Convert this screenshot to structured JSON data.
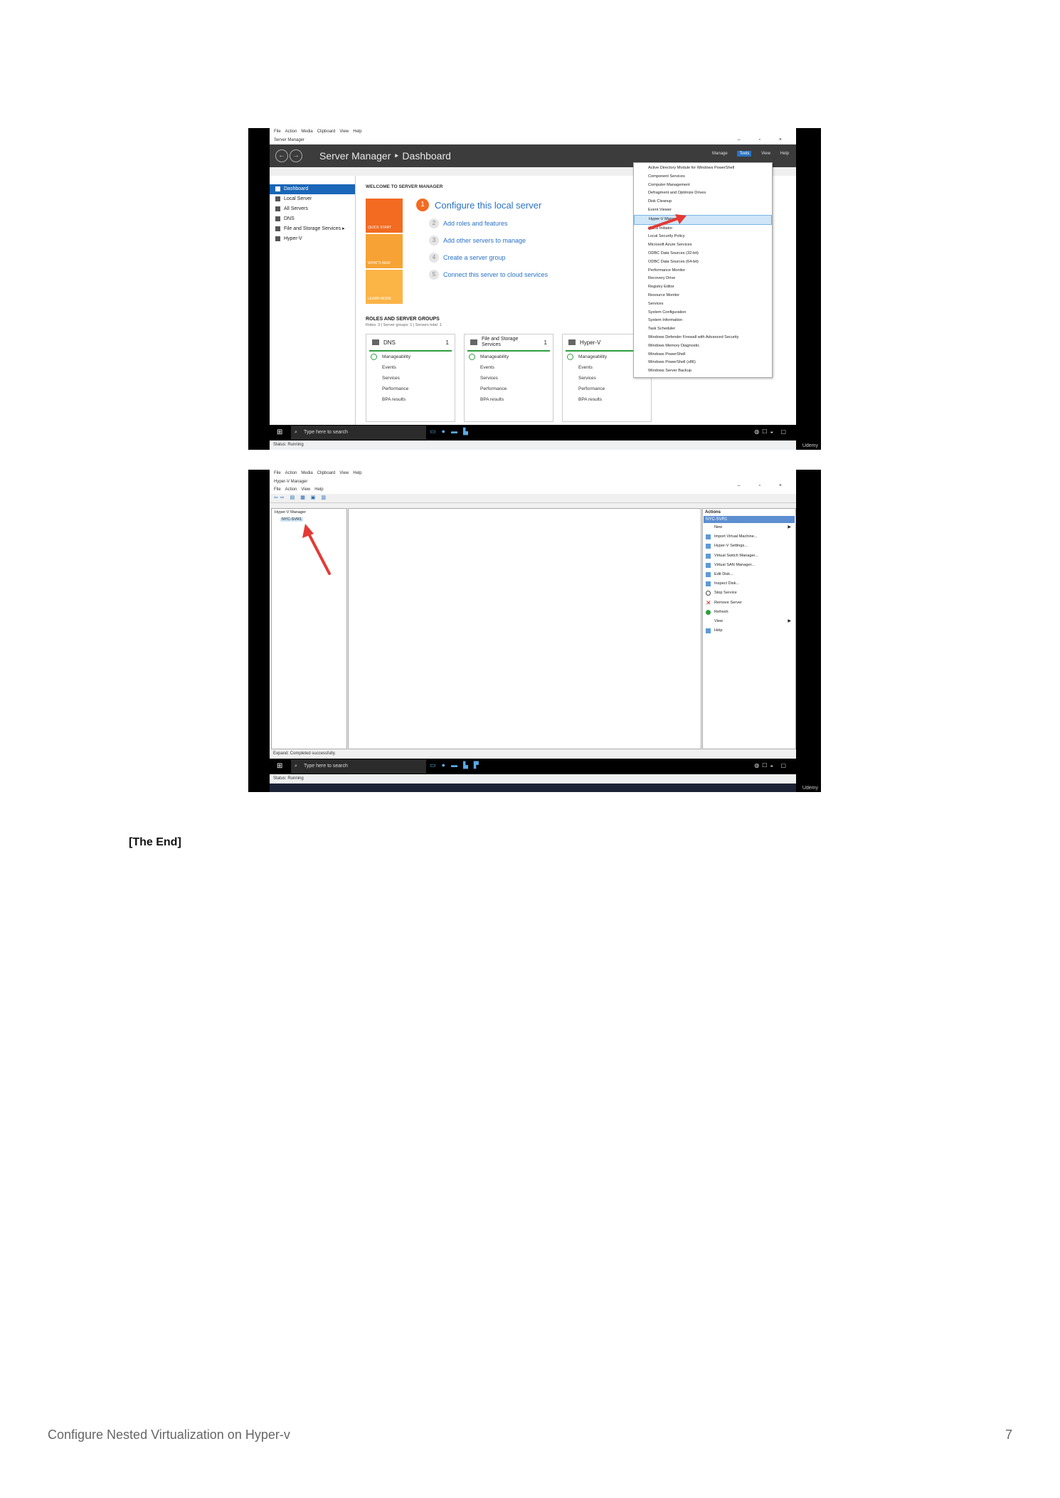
{
  "screenshot1": {
    "vm_menu": [
      "File",
      "Action",
      "Media",
      "Clipboard",
      "View",
      "Help"
    ],
    "window_title": "Server Manager",
    "window_controls": "– ▫ ×",
    "nav_back": "←",
    "nav_forward": "→",
    "header_title": "Server Manager ‣ Dashboard",
    "header_menu": {
      "manage": "Manage",
      "tools": "Tools",
      "view": "View",
      "help": "Help"
    },
    "sidebar": [
      "Dashboard",
      "Local Server",
      "All Servers",
      "DNS",
      "File and Storage Services ▸",
      "Hyper-V"
    ],
    "welcome": "WELCOME TO SERVER MANAGER",
    "tiles": [
      "QUICK START",
      "WHAT'S NEW",
      "LEARN MORE"
    ],
    "quick_start": {
      "first": {
        "num": "1",
        "label": "Configure this local server"
      },
      "items": [
        {
          "num": "2",
          "label": "Add roles and features"
        },
        {
          "num": "3",
          "label": "Add other servers to manage"
        },
        {
          "num": "4",
          "label": "Create a server group"
        },
        {
          "num": "5",
          "label": "Connect this server to cloud services"
        }
      ]
    },
    "roles_title": "ROLES AND SERVER GROUPS",
    "roles_sub": "Roles: 3 | Server groups: 1 | Servers total: 1",
    "cards": [
      {
        "name": "DNS",
        "count": "1",
        "rows": [
          "Manageability",
          "Events",
          "Services",
          "Performance",
          "BPA results"
        ]
      },
      {
        "name": "File and Storage Services",
        "count": "1",
        "rows": [
          "Manageability",
          "Events",
          "Services",
          "Performance",
          "BPA results"
        ]
      },
      {
        "name": "Hyper-V",
        "count": "1",
        "rows": [
          "Manageability",
          "Events",
          "Services",
          "Performance",
          "BPA results"
        ]
      }
    ],
    "tools_menu": [
      "Active Directory Module for Windows PowerShell",
      "Component Services",
      "Computer Management",
      "Defragment and Optimize Drives",
      "Disk Cleanup",
      "Event Viewer",
      "Hyper-V Manager",
      "iSCSI Initiator",
      "Local Security Policy",
      "Microsoft Azure Services",
      "ODBC Data Sources (32-bit)",
      "ODBC Data Sources (64-bit)",
      "Performance Monitor",
      "Recovery Drive",
      "Registry Editor",
      "Resource Monitor",
      "Services",
      "System Configuration",
      "System Information",
      "Task Scheduler",
      "Windows Defender Firewall with Advanced Security",
      "Windows Memory Diagnostic",
      "Windows PowerShell",
      "Windows PowerShell (x86)",
      "Windows Server Backup"
    ],
    "highlighted_item": "Hyper-V Manager",
    "search_placeholder": "Type here to search",
    "status": "Status: Running",
    "watermark": "Udemy"
  },
  "screenshot2": {
    "vm_menu": [
      "File",
      "Action",
      "Media",
      "Clipboard",
      "View",
      "Help"
    ],
    "window_title": "Hyper-V Manager",
    "window_controls": "– ▫ ×",
    "app_menu": [
      "File",
      "Action",
      "View",
      "Help"
    ],
    "toolbar_icons": "⇦⇨ ▤ ▦ ▣ ▥",
    "tree": {
      "root": "Hyper-V Manager",
      "child": "NYC-SVR1"
    },
    "actions_title": "Actions",
    "actions_server": "NYC-SVR1",
    "actions": [
      {
        "label": "New",
        "icon": "none",
        "submenu": true
      },
      {
        "label": "Import Virtual Machine...",
        "icon": "import-icon"
      },
      {
        "label": "Hyper-V Settings...",
        "icon": "settings-icon"
      },
      {
        "label": "Virtual Switch Manager...",
        "icon": "switch-icon"
      },
      {
        "label": "Virtual SAN Manager...",
        "icon": "san-icon"
      },
      {
        "label": "Edit Disk...",
        "icon": "edit-disk-icon"
      },
      {
        "label": "Inspect Disk...",
        "icon": "inspect-disk-icon"
      },
      {
        "label": "Stop Service",
        "icon": "stop-icon"
      },
      {
        "label": "Remove Server",
        "icon": "remove-icon"
      },
      {
        "label": "Refresh",
        "icon": "refresh-icon"
      },
      {
        "label": "View",
        "icon": "none",
        "submenu": true
      },
      {
        "label": "Help",
        "icon": "help-icon"
      }
    ],
    "app_status": "Expand: Completed successfully.",
    "search_placeholder": "Type here to search",
    "status": "Status: Running",
    "watermark": "Udemy"
  },
  "end_text": "[The End]",
  "footer": {
    "title": "Configure Nested Virtualization on Hyper-v",
    "page": "7"
  },
  "colors": {
    "accent": "#2a72c4",
    "orange": "#f26b21",
    "arrow": "#e53935",
    "selection": "#1a66b8"
  }
}
